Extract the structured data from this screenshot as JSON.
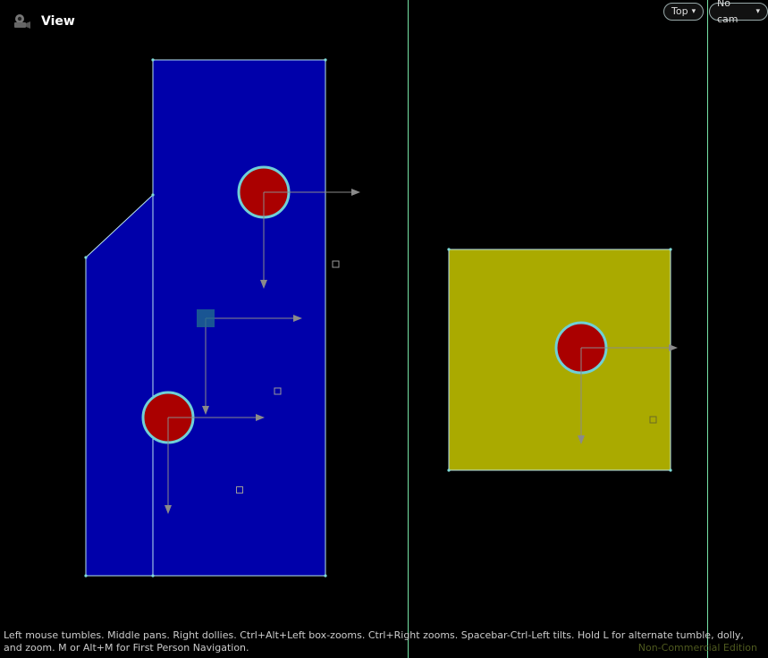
{
  "viewport": {
    "title": "View",
    "view_selector": "Top",
    "camera_selector": "No cam",
    "help_text": "Left mouse tumbles. Middle pans. Right dollies. Ctrl+Alt+Left box-zooms. Ctrl+Right zooms. Spacebar-Ctrl-Left tilts. Hold L for alternate tumble, dolly, and zoom. M or Alt+M for First Person Navigation.",
    "watermark": "Non-Commercial Edition"
  },
  "colors": {
    "background": "#000000",
    "blue_shape": "#0000aa",
    "yellow_shape": "#aaaa00",
    "red_disc": "#aa0000",
    "outline": "#7fdcd9",
    "guide_line": "#77e3a6",
    "arrow": "#888888"
  },
  "icons": {
    "view_icon": "camera-icon",
    "dropdown": "chevron-down-icon"
  }
}
